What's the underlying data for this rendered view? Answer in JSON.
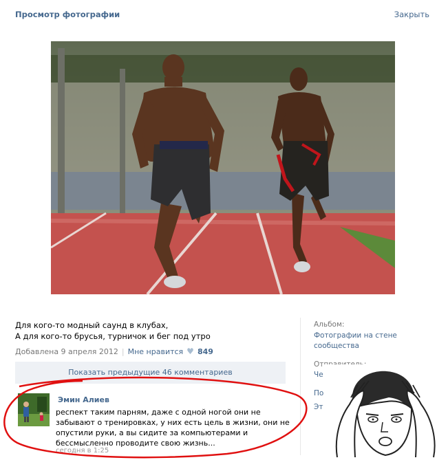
{
  "header": {
    "title": "Просмотр фотографии",
    "close_label": "Закрыть"
  },
  "photo": {
    "description_icon": "photo-two-sprinters"
  },
  "caption": {
    "line1": "Для кого-то модный саунд в клубах,",
    "line2": "А для кого-то брусья, турничок и бег под утро"
  },
  "meta": {
    "added": "Добавлена 9 апреля 2012",
    "separator": "|",
    "like_label": "Мне нравится",
    "like_count": "849"
  },
  "comments_more": "Показать предыдущие 46 комментариев",
  "sidebar": {
    "album_label": "Альбом:",
    "album_value_line1": "Фотографии на стене",
    "album_value_line2": "сообщества",
    "sender_label": "Отправитель:",
    "sender_value": "Че бор",
    "extra1": "Под",
    "extra2": "Эт"
  },
  "comment": {
    "author": "Эмин Алиев",
    "text": "респект таким парням, даже с одной ногой они не забывают о тренировках, у них есть цель в жизни, они не опустили руки, а вы сидите за компьютерами и бессмысленно проводите свою жизнь...",
    "time": "сегодня в 1:25"
  },
  "colors": {
    "link": "#45688e",
    "highlight_red": "#e01010",
    "track": "#c4524e"
  }
}
